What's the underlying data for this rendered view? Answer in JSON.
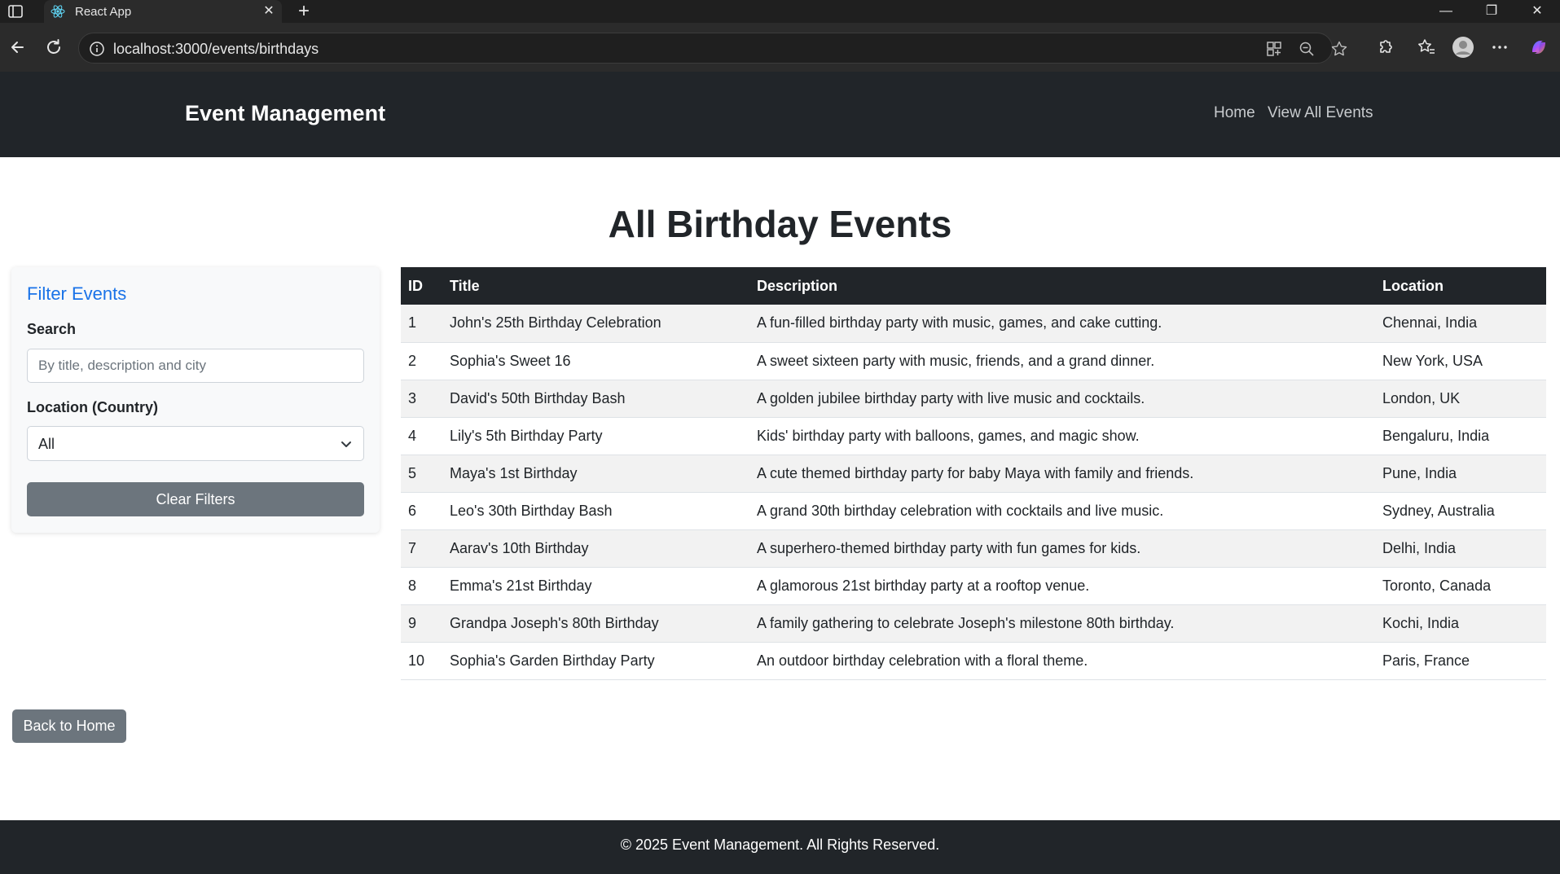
{
  "browser": {
    "tab_title": "React App",
    "tab_close": "✕",
    "new_tab": "+",
    "url": "localhost:3000/events/birthdays",
    "window_controls": {
      "minimize": "—",
      "restore": "❐",
      "close": "✕"
    }
  },
  "navbar": {
    "brand": "Event Management",
    "links": [
      "Home",
      "View All Events"
    ]
  },
  "page": {
    "title": "All Birthday Events"
  },
  "filters": {
    "heading": "Filter Events",
    "search_label": "Search",
    "search_placeholder": "By title, description and city",
    "search_value": "",
    "location_label": "Location (Country)",
    "location_selected": "All",
    "clear_label": "Clear Filters"
  },
  "table": {
    "columns": [
      "ID",
      "Title",
      "Description",
      "Location"
    ],
    "rows": [
      [
        "1",
        "John's 25th Birthday Celebration",
        "A fun-filled birthday party with music, games, and cake cutting.",
        "Chennai, India"
      ],
      [
        "2",
        "Sophia's Sweet 16",
        "A sweet sixteen party with music, friends, and a grand dinner.",
        "New York, USA"
      ],
      [
        "3",
        "David's 50th Birthday Bash",
        "A golden jubilee birthday party with live music and cocktails.",
        "London, UK"
      ],
      [
        "4",
        "Lily's 5th Birthday Party",
        "Kids' birthday party with balloons, games, and magic show.",
        "Bengaluru, India"
      ],
      [
        "5",
        "Maya's 1st Birthday",
        "A cute themed birthday party for baby Maya with family and friends.",
        "Pune, India"
      ],
      [
        "6",
        "Leo's 30th Birthday Bash",
        "A grand 30th birthday celebration with cocktails and live music.",
        "Sydney, Australia"
      ],
      [
        "7",
        "Aarav's 10th Birthday",
        "A superhero-themed birthday party with fun games for kids.",
        "Delhi, India"
      ],
      [
        "8",
        "Emma's 21st Birthday",
        "A glamorous 21st birthday party at a rooftop venue.",
        "Toronto, Canada"
      ],
      [
        "9",
        "Grandpa Joseph's 80th Birthday",
        "A family gathering to celebrate Joseph's milestone 80th birthday.",
        "Kochi, India"
      ],
      [
        "10",
        "Sophia's Garden Birthday Party",
        "An outdoor birthday celebration with a floral theme.",
        "Paris, France"
      ]
    ]
  },
  "back_button": "Back to Home",
  "footer": {
    "text": "© 2025 Event Management. All Rights Reserved."
  },
  "colors": {
    "navbar_bg": "#212529",
    "filter_heading": "#1a73e8",
    "button_secondary": "#6c757d"
  },
  "icons": [
    "sidebar-toggle-icon",
    "react-logo-icon",
    "back-arrow-icon",
    "reload-icon",
    "site-info-icon",
    "app-grid-icon",
    "zoom-out-icon",
    "favorite-star-icon",
    "extensions-icon",
    "favorites-list-icon",
    "profile-avatar-icon",
    "more-menu-icon",
    "copilot-icon",
    "chevron-down-icon"
  ]
}
